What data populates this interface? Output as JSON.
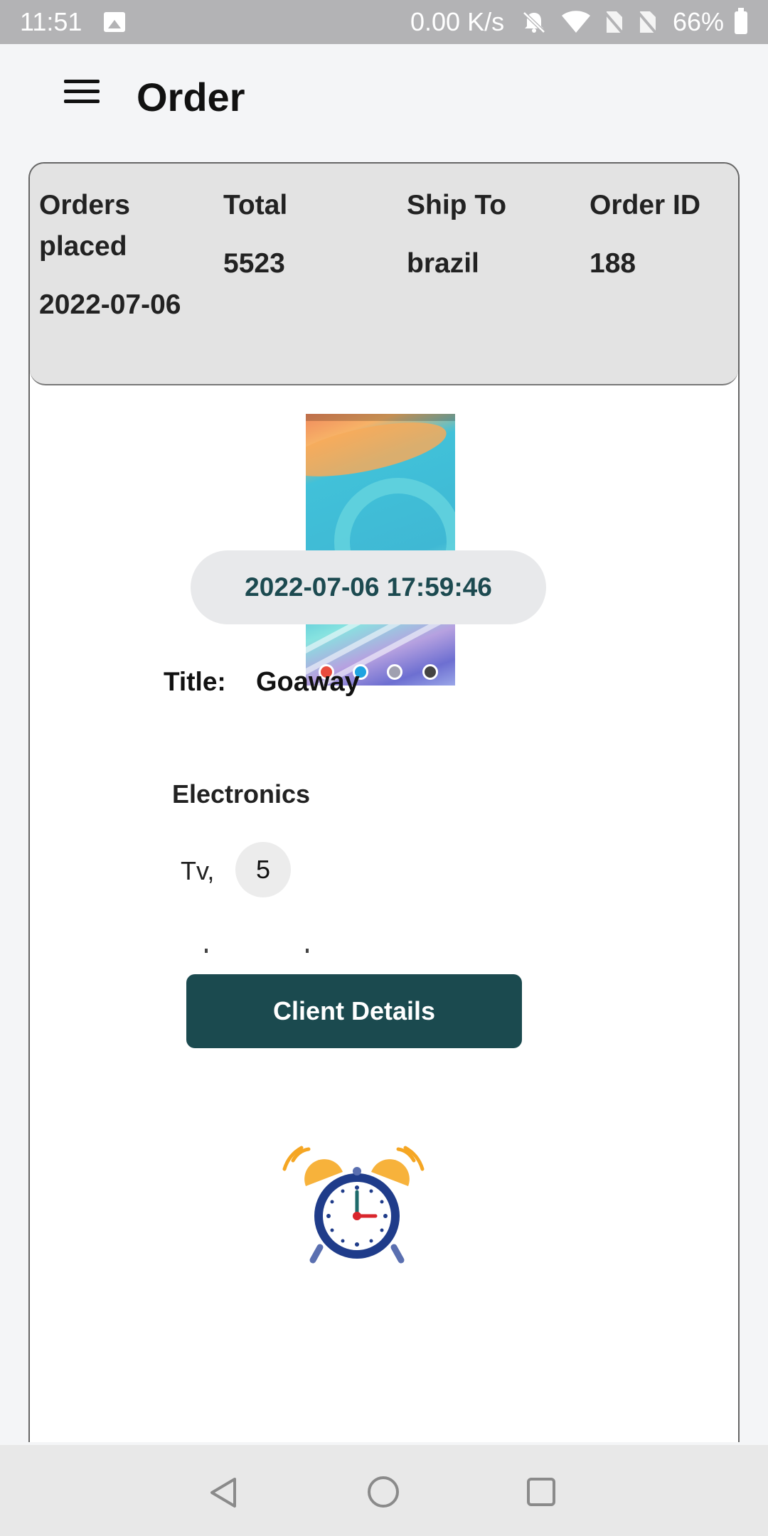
{
  "status_bar": {
    "time": "11:51",
    "network_speed": "0.00 K/s",
    "battery_percent": "66%",
    "icons": [
      "image-icon",
      "bell-muted-icon",
      "wifi-icon",
      "no-sim-icon",
      "no-sim-icon",
      "battery-icon"
    ]
  },
  "app_bar": {
    "menu_icon": "hamburger-menu-icon",
    "title": "Order"
  },
  "order_summary": {
    "orders_placed_label": "Orders placed",
    "orders_placed_value": "2022-07-06",
    "total_label": "Total",
    "total_value": "5523",
    "ship_to_label": "Ship To",
    "ship_to_value": "brazil",
    "order_id_label": "Order ID",
    "order_id_value": "188"
  },
  "order_detail": {
    "timestamp": "2022-07-06 17:59:46",
    "title_label": "Title:",
    "title_value": "Goaway",
    "category": "Electronics",
    "item_name": "Tv,",
    "item_quantity": "5",
    "client_button_label": "Client Details"
  },
  "nav_bar": {
    "icons": [
      "back-icon",
      "home-icon",
      "recent-apps-icon"
    ]
  },
  "colors": {
    "accent": "#1b4a4f",
    "header_bg": "#e3e3e3",
    "status_bar_bg": "#b3b3b5"
  }
}
